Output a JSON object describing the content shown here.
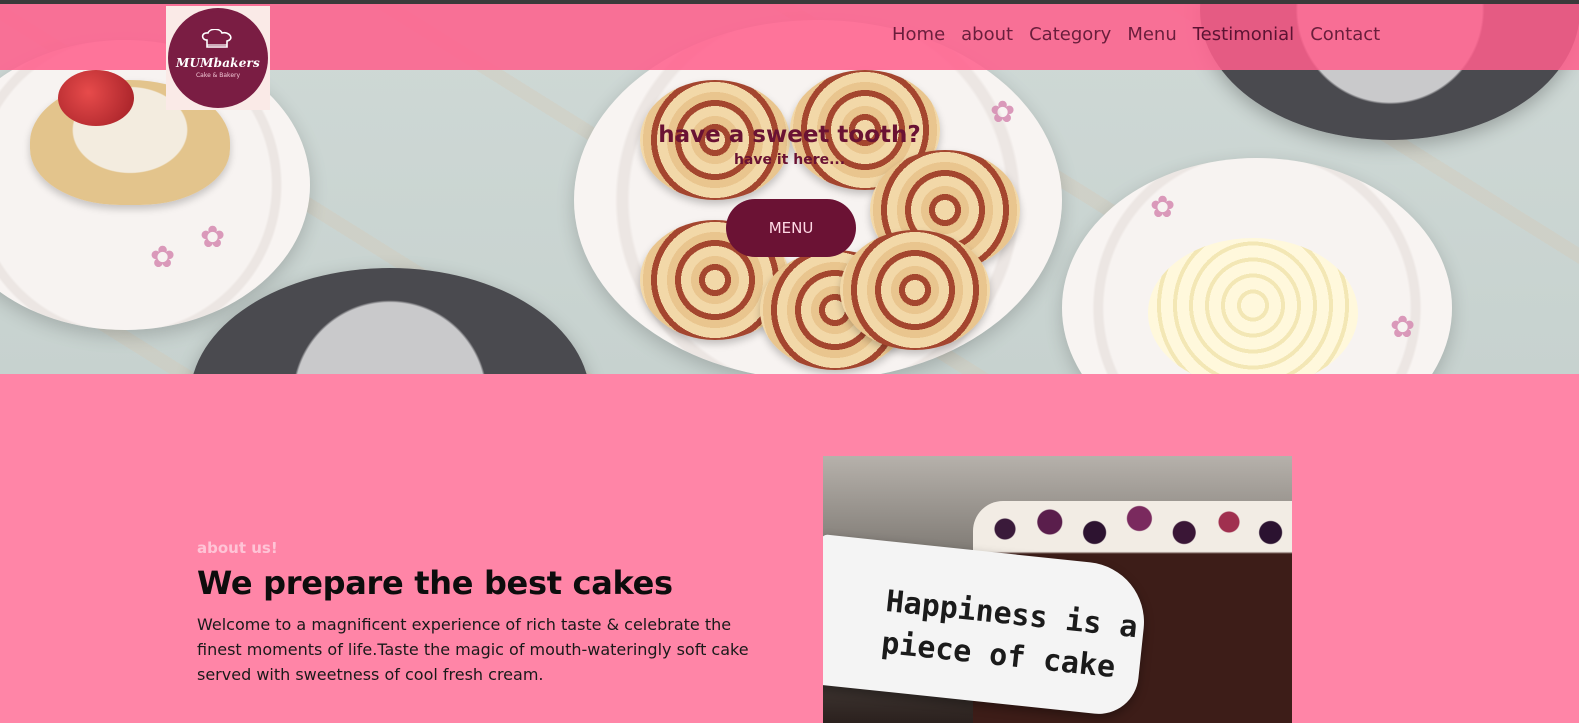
{
  "logo": {
    "name": "MUMbakers",
    "tagline": "Cake & Bakery"
  },
  "nav": {
    "items": [
      {
        "label": "Home"
      },
      {
        "label": "about"
      },
      {
        "label": "Category"
      },
      {
        "label": "Menu"
      },
      {
        "label": "Testimonial"
      },
      {
        "label": "Contact"
      }
    ],
    "active": "Testimonial"
  },
  "hero": {
    "title": "have a sweet tooth?",
    "subtitle": "have it here...",
    "button_label": "MENU"
  },
  "about": {
    "kicker": "about us!",
    "title": "We prepare the best cakes",
    "text": "Welcome to a magnificent experience of rich taste & celebrate the finest moments of life.Taste the magic of mouth-wateringly soft cake served with sweetness of cool fresh cream.",
    "image_text": "Happiness is a\npiece of cake"
  },
  "colors": {
    "nav_bg": "#ff5e8c",
    "section_bg": "#ff85a7",
    "accent": "#6b1234"
  }
}
